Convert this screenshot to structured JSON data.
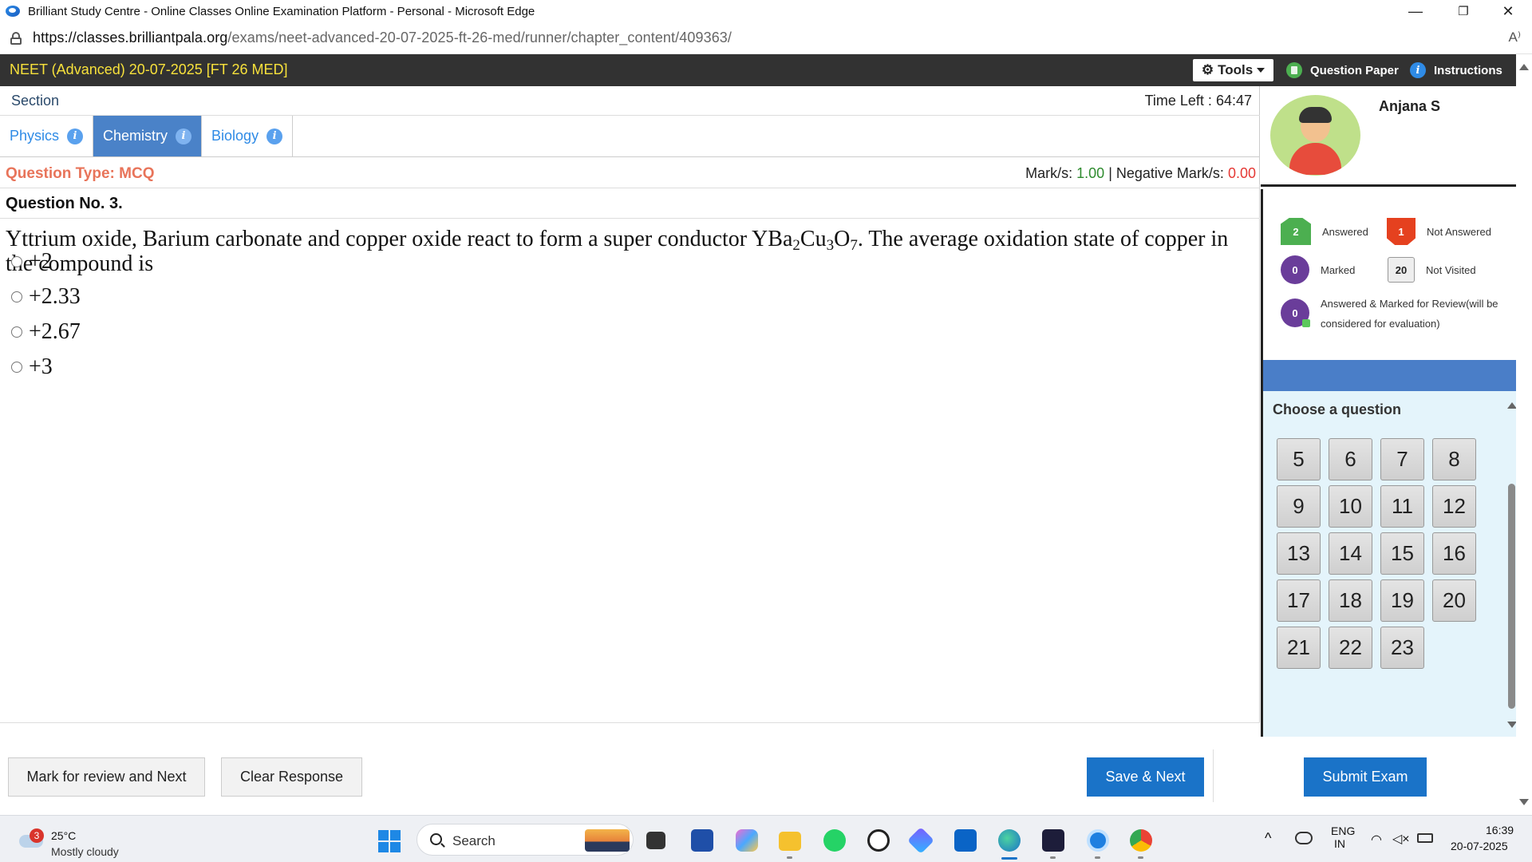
{
  "browser": {
    "title": "Brilliant Study Centre - Online Classes Online Examination Platform - Personal - Microsoft Edge",
    "url_host": "https://classes.brilliantpala.org",
    "url_path": "/exams/neet-advanced-20-07-2025-ft-26-med/runner/chapter_content/409363/",
    "minimize": "—",
    "restore": "❐",
    "close": "✕",
    "read_aloud": "A⁾"
  },
  "exam": {
    "title": "NEET (Advanced) 20-07-2025 [FT 26 MED]",
    "tools_label": "Tools",
    "tools_icon": "⚙",
    "question_paper_label": "Question Paper",
    "instructions_label": "Instructions",
    "info_glyph": "i"
  },
  "section": {
    "label": "Section",
    "time_left_label": "Time Left :",
    "time_left_value": "64:47",
    "tabs": [
      {
        "label": "Physics",
        "active": false
      },
      {
        "label": "Chemistry",
        "active": true
      },
      {
        "label": "Biology",
        "active": false
      }
    ]
  },
  "question": {
    "type_label": "Question Type: MCQ",
    "marks_label": "Mark/s:",
    "marks_value": "1.00",
    "separator": "|",
    "negative_label": "Negative Mark/s:",
    "negative_value": "0.00",
    "number_label": "Question No. 3.",
    "text_part1": "Yttrium oxide, Barium carbonate and copper oxide react to form a super conductor YBa",
    "sub1": "2",
    "text_cu": "Cu",
    "sub2": "3",
    "text_o": "O",
    "sub3": "7",
    "text_part2": ". The average oxidation state of copper in the compound is",
    "options": [
      "+2",
      "+2.33",
      "+2.67",
      "+3"
    ]
  },
  "profile": {
    "name": "Anjana S"
  },
  "legend": {
    "answered_count": "2",
    "answered_label": "Answered",
    "not_answered_count": "1",
    "not_answered_label": "Not Answered",
    "marked_count": "0",
    "marked_label": "Marked",
    "not_visited_count": "20",
    "not_visited_label": "Not Visited",
    "amr_count": "0",
    "amr_label_line1": "Answered & Marked for Review(will be",
    "amr_label_line2": "considered for evaluation)"
  },
  "palette": {
    "heading": "Choose a question",
    "questions": [
      "5",
      "6",
      "7",
      "8",
      "9",
      "10",
      "11",
      "12",
      "13",
      "14",
      "15",
      "16",
      "17",
      "18",
      "19",
      "20",
      "21",
      "22",
      "23"
    ]
  },
  "actions": {
    "mark_review": "Mark for review and Next",
    "clear": "Clear Response",
    "save_next": "Save & Next",
    "submit": "Submit Exam"
  },
  "taskbar": {
    "weather_alert": "3",
    "temperature": "25°C",
    "condition": "Mostly cloudy",
    "search_placeholder": "Search",
    "lang_line1": "ENG",
    "lang_line2": "IN",
    "time": "16:39",
    "date": "20-07-2025",
    "tray_chevron": "^"
  },
  "colors": {
    "header_bg": "#323232",
    "exam_title": "#f7e13b",
    "active_tab": "#4a82c8",
    "question_type": "#e8745a",
    "positive_mark": "#2e8b2e",
    "negative_mark": "#e53935",
    "primary_button": "#1a73c8",
    "answered": "#4caf50",
    "not_answered": "#e5411f",
    "marked": "#6a3d9a",
    "palette_bg": "#e4f4fb"
  }
}
